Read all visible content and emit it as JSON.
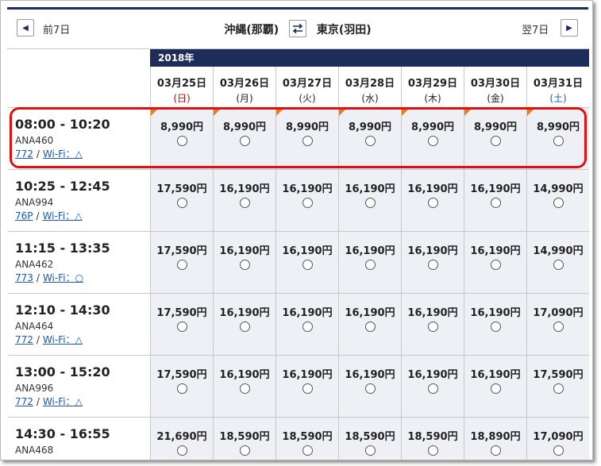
{
  "nav": {
    "prev_label": "前7日",
    "next_label": "翌7日",
    "origin": "沖縄(那覇)",
    "destination": "東京(羽田)"
  },
  "year": "2018年",
  "dates": [
    {
      "date": "03月25日",
      "weekday": "(日)",
      "type": "sun"
    },
    {
      "date": "03月26日",
      "weekday": "(月)",
      "type": "weekday"
    },
    {
      "date": "03月27日",
      "weekday": "(火)",
      "type": "weekday"
    },
    {
      "date": "03月28日",
      "weekday": "(水)",
      "type": "weekday"
    },
    {
      "date": "03月29日",
      "weekday": "(木)",
      "type": "weekday"
    },
    {
      "date": "03月30日",
      "weekday": "(金)",
      "type": "weekday"
    },
    {
      "date": "03月31日",
      "weekday": "(土)",
      "type": "sat"
    }
  ],
  "flights": [
    {
      "time": "08:00 - 10:20",
      "flight_no": "ANA460",
      "aircraft": "772",
      "sep": "/",
      "wifi": "Wi-Fi：△",
      "badge": true,
      "prices": [
        "8,990円",
        "8,990円",
        "8,990円",
        "8,990円",
        "8,990円",
        "8,990円",
        "8,990円"
      ]
    },
    {
      "time": "10:25 - 12:45",
      "flight_no": "ANA994",
      "aircraft": "76P",
      "sep": "/",
      "wifi": "Wi-Fi：△",
      "badge": false,
      "prices": [
        "17,590円",
        "16,190円",
        "16,190円",
        "16,190円",
        "16,190円",
        "16,190円",
        "14,990円"
      ]
    },
    {
      "time": "11:15 - 13:35",
      "flight_no": "ANA462",
      "aircraft": "773",
      "sep": "/",
      "wifi": "Wi-Fi：○",
      "badge": false,
      "prices": [
        "17,590円",
        "16,190円",
        "16,190円",
        "16,190円",
        "16,190円",
        "16,190円",
        "14,990円"
      ]
    },
    {
      "time": "12:10 - 14:30",
      "flight_no": "ANA464",
      "aircraft": "772",
      "sep": "/",
      "wifi": "Wi-Fi：△",
      "badge": false,
      "prices": [
        "17,590円",
        "16,190円",
        "16,190円",
        "16,190円",
        "16,190円",
        "16,190円",
        "17,090円"
      ]
    },
    {
      "time": "13:00 - 15:20",
      "flight_no": "ANA996",
      "aircraft": "772",
      "sep": "/",
      "wifi": "Wi-Fi：△",
      "badge": false,
      "prices": [
        "17,590円",
        "16,190円",
        "16,190円",
        "16,190円",
        "16,190円",
        "16,190円",
        "17,590円"
      ]
    },
    {
      "time": "14:30 - 16:55",
      "flight_no": "ANA468",
      "aircraft": "",
      "sep": "",
      "wifi": "",
      "badge": false,
      "prices": [
        "21,690円",
        "18,590円",
        "18,590円",
        "18,590円",
        "18,590円",
        "18,890円",
        "17,090円"
      ]
    }
  ]
}
